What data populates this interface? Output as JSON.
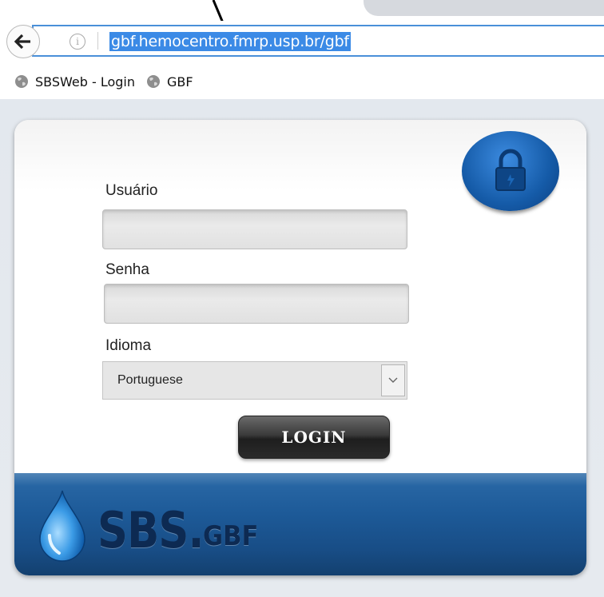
{
  "browser": {
    "url": "gbf.hemocentro.fmrp.usp.br/gbf",
    "back_icon": "arrow-left-icon",
    "info_icon": "i",
    "url_highlight_color": "#3b8ae6",
    "focus_border_color": "#4a90d9"
  },
  "bookmarks": [
    {
      "label": "SBSWeb - Login",
      "icon": "globe-icon"
    },
    {
      "label": "GBF",
      "icon": "globe-icon"
    }
  ],
  "login": {
    "username_label": "Usuário",
    "username_value": "",
    "password_label": "Senha",
    "password_value": "",
    "language_label": "Idioma",
    "language_value": "Portuguese",
    "login_button": "LOGIN",
    "lock_icon": "padlock-icon",
    "accent_color": "#1d5a98"
  },
  "footer": {
    "logo_main": "SBS.",
    "logo_suffix": "GBF",
    "logo_icon": "water-drop-icon"
  }
}
